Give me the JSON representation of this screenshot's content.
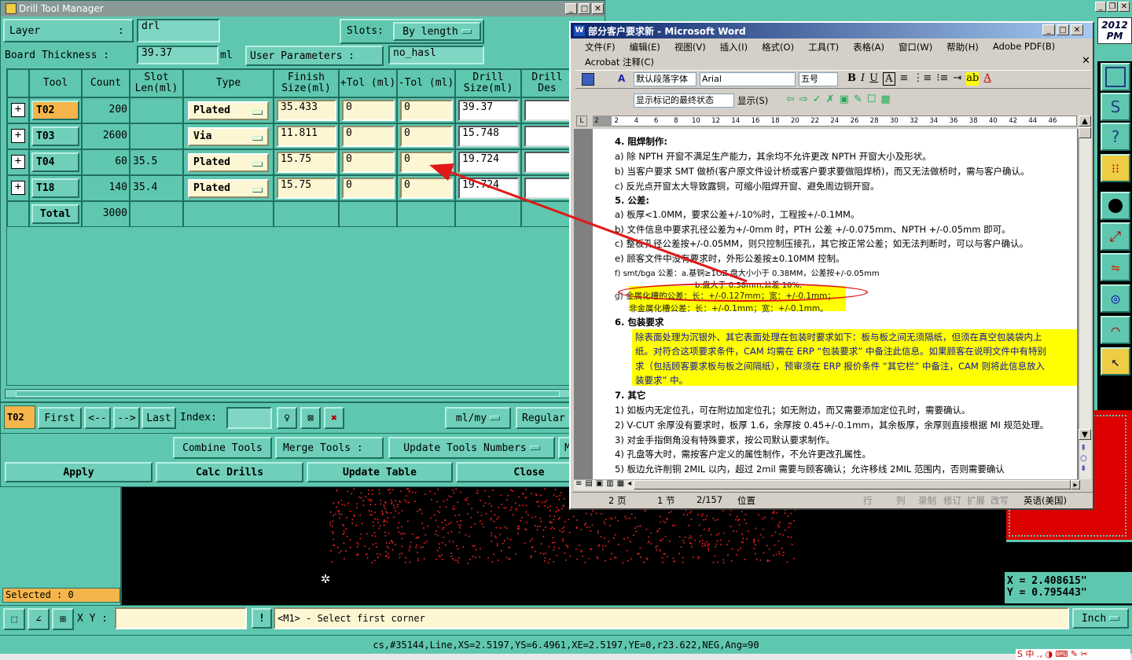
{
  "drill": {
    "title": "Drill Tool Manager",
    "layer_label": "Layer",
    "layer_colon": ":",
    "layer_value": "drl",
    "slots_label": "Slots:",
    "slots_value": "By length",
    "thickness_label": "Board Thickness :",
    "thickness_value": "39.37",
    "thickness_unit": "ml",
    "user_params_label": "User Parameters :",
    "user_params_value": "no_hasl",
    "columns": [
      "Tool",
      "Count",
      "Slot Len(ml)",
      "Type",
      "Finish Size(ml)",
      "+Tol (ml)",
      "-Tol (ml)",
      "Drill Size(ml)",
      "Drill Des"
    ],
    "rows": [
      {
        "tool": "T02",
        "count": "200",
        "slot": "",
        "type": "Plated",
        "finish": "35.433",
        "ptol": "0",
        "ntol": "0",
        "drill": "39.37",
        "desc": ""
      },
      {
        "tool": "T03",
        "count": "2600",
        "slot": "",
        "type": "Via",
        "finish": "11.811",
        "ptol": "0",
        "ntol": "0",
        "drill": "15.748",
        "desc": ""
      },
      {
        "tool": "T04",
        "count": "60",
        "slot": "35.5",
        "type": "Plated",
        "finish": "15.75",
        "ptol": "0",
        "ntol": "0",
        "drill": "19.724",
        "desc": ""
      },
      {
        "tool": "T18",
        "count": "140",
        "slot": "35.4",
        "type": "Plated",
        "finish": "15.75",
        "ptol": "0",
        "ntol": "0",
        "drill": "19.724",
        "desc": ""
      }
    ],
    "total_label": "Total",
    "total_count": "3000",
    "nav": {
      "current": "T02",
      "first": "First",
      "prev": "<--",
      "next": "-->",
      "last": "Last",
      "index_label": "Index:",
      "units": "ml/my",
      "regular": "Regular"
    },
    "actions": {
      "combine": "Combine Tools",
      "merge": "Merge Tools :",
      "update_numbers": "Update Tools Numbers",
      "m": "M"
    },
    "bottom": {
      "apply": "Apply",
      "calc": "Calc Drills",
      "update_table": "Update Table",
      "close": "Close"
    }
  },
  "word": {
    "title": "部分客户要求新 - Microsoft Word",
    "menu": [
      "文件(F)",
      "编辑(E)",
      "视图(V)",
      "插入(I)",
      "格式(O)",
      "工具(T)",
      "表格(A)",
      "窗口(W)",
      "帮助(H)",
      "Adobe PDF(B)"
    ],
    "acrobat": "Acrobat 注释(C)",
    "style": "默认段落字体",
    "font": "Arial",
    "size": "五号",
    "markup": "显示标记的最终状态",
    "show": "显示(S)",
    "ruler": [
      "2",
      "2",
      "4",
      "6",
      "8",
      "10",
      "12",
      "14",
      "16",
      "18",
      "20",
      "22",
      "24",
      "26",
      "28",
      "30",
      "32",
      "34",
      "36",
      "38",
      "40",
      "42",
      "44",
      "46"
    ],
    "lines": [
      "4.  阻焊制作:",
      "a)  除 NPTH 开窗不满足生产能力，其余均不允许更改 NPTH 开窗大小及形状。",
      "b)  当客户要求 SMT 做桥(客户原文件设计桥或客户要求要做阻焊桥)，而又无法做桥时，需与客户确认。",
      "c)  反光点开窗太大导致露铜，可缩小阻焊开窗、避免周边铜开窗。",
      "5.  公差:",
      "a)  板厚<1.0MM，要求公差+/-10%时，工程按+/-0.1MM。",
      "b)  文件信息中要求孔径公差为+/-0mm 时，PTH 公差 +/-0.075mm、NPTH +/-0.05mm 即可。",
      "c)  整板孔径公差按+/-0.05MM，则只控制压接孔，其它按正常公差；如无法判断时，可以与客户确认。",
      "e)  顾客文件中没有要求时，外形公差按±0.10MM 控制。",
      "f)  smt/bga 公差：a.基铜≥1OZ 盘大小小于 0.38MM，公差按+/-0.05mm",
      "b.盘大于 0.38mm,公差 10%.",
      "g)  金属化槽的公差：长：+/-0.127mm；宽：+/-0.1mm；",
      "非金属化槽公差：长：+/-0.1mm；宽：+/-0.1mm。",
      "6.  包装要求",
      "除表面处理为沉银外、其它表面处理在包装时要求如下：板与板之间无须隔纸，但须在真空包装袋内上",
      "纸。对符合这项要求条件，CAM 均需在 ERP “包装要求” 中备注此信息。如果顾客在说明文件中有特别",
      "求（包括顾客要求板与板之间隔纸），预审须在 ERP 报价条件 “其它栏” 中备注，CAM 则将此信息放入",
      "装要求” 中。",
      "7.  其它",
      "1)  如板内无定位孔，可在附边加定位孔；如无附边，而又需要添加定位孔时，需要确认。",
      "2)  V-CUT 余厚没有要求时，板厚 1.6，余厚按 0.45+/-0.1mm，其余板厚，余厚则直接根据 MI 规范处理。",
      "3)  对金手指倒角没有特殊要求，按公司默认要求制作。",
      "4)  孔盘等大时，需按客户定义的属性制作，不允许更改孔属性。",
      "5)  板边允许削铜 2MIL 以内，超过 2mil 需要与顾客确认；允许移线 2MIL 范围内，否则需要确认"
    ],
    "status": {
      "page": "2 页",
      "section": "1 节",
      "position": "2/157",
      "at": "位置",
      "line": "行",
      "col": "列",
      "rec": "录制",
      "trk": "修订",
      "ext": "扩展",
      "ovr": "改写",
      "lang": "英语(美国)"
    }
  },
  "cad": {
    "clock": "2012 PM",
    "selected": "Selected : 0",
    "xy_label": "X Y :",
    "xy_value": "",
    "message": "<M1> - Select first corner",
    "coord_x": "X = 2.408615\"",
    "coord_y": "Y = 0.795443\"",
    "units": "Inch",
    "status_line": "cs,#35144,Line,XS=2.5197,YS=6.4961,XE=2.5197,YE=0,r23.622,NEG,Ang=90"
  }
}
